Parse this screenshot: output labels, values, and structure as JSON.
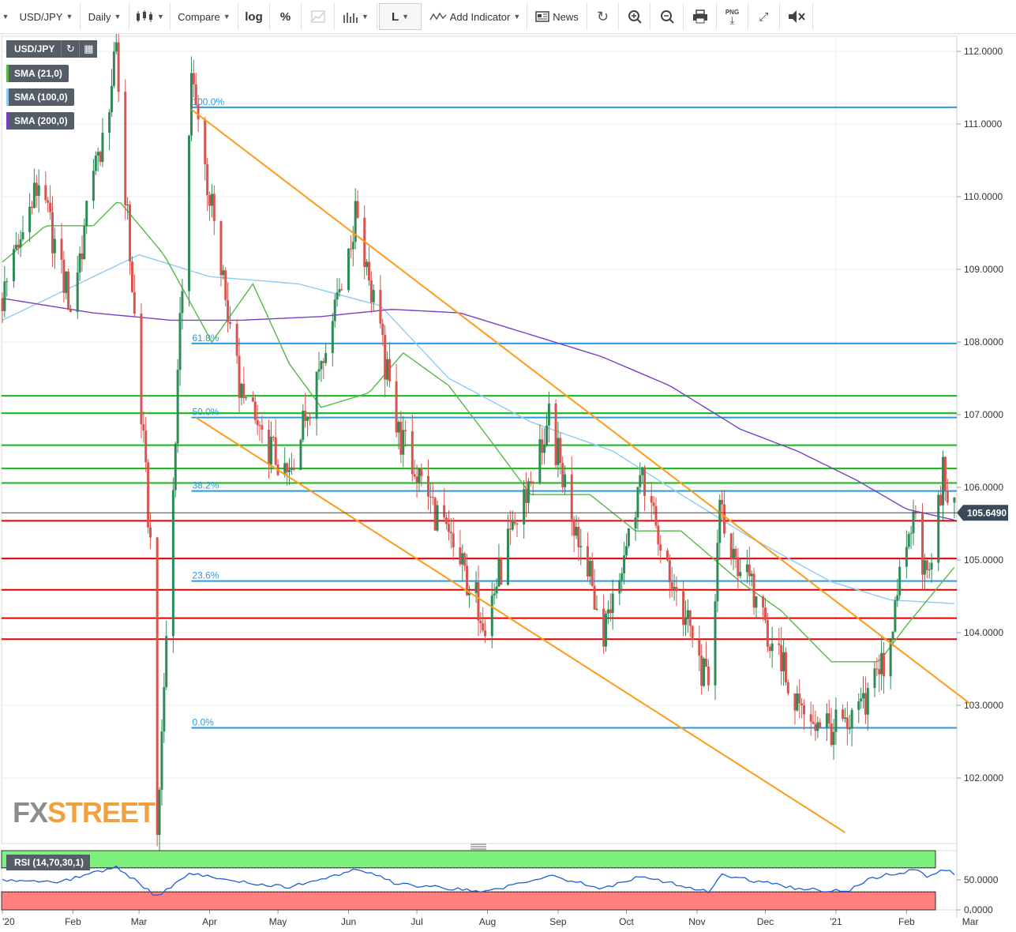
{
  "toolbar": {
    "symbol": "USD/JPY",
    "interval": "Daily",
    "compare": "Compare",
    "log": "log",
    "percent": "%",
    "line_tool": "L",
    "add_indicator": "Add Indicator",
    "news": "News",
    "png": "PNG"
  },
  "legend": {
    "pair": "USD/JPY",
    "sma21": "SMA (21,0)",
    "sma100": "SMA (100,0)",
    "sma200": "SMA (200,0)",
    "rsi": "RSI (14,70,30,1)"
  },
  "watermark": {
    "fx": "FX",
    "street": "STREET"
  },
  "colors": {
    "up": "#2e8b57",
    "down": "#d9534f",
    "sma21": "#55b848",
    "sma100": "#8ecbf2",
    "sma200": "#7a3fc4",
    "fib": "#2a9ae0",
    "support": "#e00000",
    "resistance": "#11bb11",
    "channel": "#ff9a1a",
    "rsi_line": "#1f5fd6",
    "rsi_over": "#7df07d",
    "rsi_under": "#ff7f7f"
  },
  "chart_data": {
    "type": "candlestick",
    "title": "USD/JPY Daily",
    "current_price": 105.649,
    "current_price_label": "105.6490",
    "y_ticks": [
      "112.0000",
      "111.0000",
      "110.0000",
      "109.0000",
      "108.0000",
      "107.0000",
      "106.0000",
      "105.0000",
      "104.0000",
      "103.0000",
      "102.0000"
    ],
    "y_tick_values": [
      112,
      111,
      110,
      109,
      108,
      107,
      106,
      105,
      104,
      103,
      102
    ],
    "x_labels": [
      "'20",
      "Feb",
      "Mar",
      "Apr",
      "May",
      "Jun",
      "Jul",
      "Aug",
      "Sep",
      "Oct",
      "Nov",
      "Dec",
      "'21",
      "Feb",
      "Mar"
    ],
    "ylim": [
      101.15,
      112.2
    ],
    "fibonacci": [
      {
        "label": "100.0%",
        "price": 111.23
      },
      {
        "label": "61.8%",
        "price": 107.98
      },
      {
        "label": "50.0%",
        "price": 106.96
      },
      {
        "label": "38.2%",
        "price": 105.95
      },
      {
        "label": "23.6%",
        "price": 104.71
      },
      {
        "label": "0.0%",
        "price": 102.69
      }
    ],
    "resistance_levels": [
      107.26,
      107.02,
      106.58,
      106.26,
      106.06
    ],
    "support_levels": [
      105.54,
      105.02,
      104.59,
      104.2,
      103.91
    ],
    "trendlines": [
      {
        "from": {
          "date": "2020-03-24",
          "price": 111.2
        },
        "to": {
          "date": "2021-03-01",
          "price": 103.02
        }
      },
      {
        "from": {
          "date": "2020-03-26",
          "price": 106.96
        },
        "to": {
          "date": "2021-01-05",
          "price": 101.25
        }
      }
    ],
    "ohlc_keypoints": [
      {
        "date": "2020-01-01",
        "price": 108.6
      },
      {
        "date": "2020-01-17",
        "price": 110.2
      },
      {
        "date": "2020-01-31",
        "price": 108.5
      },
      {
        "date": "2020-02-20",
        "price": 111.9
      },
      {
        "date": "2020-03-06",
        "price": 105.2
      },
      {
        "date": "2020-03-09",
        "price": 101.2
      },
      {
        "date": "2020-03-24",
        "price": 111.6
      },
      {
        "date": "2020-04-15",
        "price": 107.2
      },
      {
        "date": "2020-05-06",
        "price": 106.1
      },
      {
        "date": "2020-06-05",
        "price": 109.8
      },
      {
        "date": "2020-06-22",
        "price": 106.8
      },
      {
        "date": "2020-07-31",
        "price": 104.2
      },
      {
        "date": "2020-08-28",
        "price": 106.9
      },
      {
        "date": "2020-09-21",
        "price": 104.0
      },
      {
        "date": "2020-10-07",
        "price": 106.1
      },
      {
        "date": "2020-11-06",
        "price": 103.2
      },
      {
        "date": "2020-11-11",
        "price": 105.6
      },
      {
        "date": "2020-12-17",
        "price": 102.9
      },
      {
        "date": "2021-01-06",
        "price": 102.6
      },
      {
        "date": "2021-01-22",
        "price": 103.6
      },
      {
        "date": "2021-02-05",
        "price": 105.7
      },
      {
        "date": "2021-02-10",
        "price": 104.6
      },
      {
        "date": "2021-02-17",
        "price": 106.2
      },
      {
        "date": "2021-02-22",
        "price": 105.65
      }
    ],
    "sma21_keypoints": [
      {
        "date": "2020-01-01",
        "price": 109.1
      },
      {
        "date": "2020-01-20",
        "price": 109.6
      },
      {
        "date": "2020-02-10",
        "price": 109.6
      },
      {
        "date": "2020-02-21",
        "price": 109.95
      },
      {
        "date": "2020-03-12",
        "price": 109.2
      },
      {
        "date": "2020-04-02",
        "price": 108.0
      },
      {
        "date": "2020-04-20",
        "price": 108.8
      },
      {
        "date": "2020-05-06",
        "price": 107.7
      },
      {
        "date": "2020-05-20",
        "price": 107.1
      },
      {
        "date": "2020-06-10",
        "price": 107.3
      },
      {
        "date": "2020-06-25",
        "price": 107.85
      },
      {
        "date": "2020-07-15",
        "price": 107.4
      },
      {
        "date": "2020-08-01",
        "price": 106.7
      },
      {
        "date": "2020-08-20",
        "price": 105.9
      },
      {
        "date": "2020-09-15",
        "price": 105.9
      },
      {
        "date": "2020-10-05",
        "price": 105.4
      },
      {
        "date": "2020-10-25",
        "price": 105.4
      },
      {
        "date": "2020-11-20",
        "price": 104.7
      },
      {
        "date": "2020-12-08",
        "price": 104.3
      },
      {
        "date": "2020-12-30",
        "price": 103.6
      },
      {
        "date": "2021-01-20",
        "price": 103.6
      },
      {
        "date": "2021-02-01",
        "price": 104.1
      },
      {
        "date": "2021-02-22",
        "price": 104.9
      }
    ],
    "sma100_keypoints": [
      {
        "date": "2020-01-01",
        "price": 108.3
      },
      {
        "date": "2020-02-10",
        "price": 108.9
      },
      {
        "date": "2020-03-01",
        "price": 109.2
      },
      {
        "date": "2020-04-01",
        "price": 108.9
      },
      {
        "date": "2020-05-10",
        "price": 108.8
      },
      {
        "date": "2020-06-15",
        "price": 108.5
      },
      {
        "date": "2020-07-15",
        "price": 107.5
      },
      {
        "date": "2020-08-20",
        "price": 106.9
      },
      {
        "date": "2020-09-25",
        "price": 106.5
      },
      {
        "date": "2020-10-25",
        "price": 105.9
      },
      {
        "date": "2020-11-25",
        "price": 105.3
      },
      {
        "date": "2020-12-30",
        "price": 104.7
      },
      {
        "date": "2021-01-25",
        "price": 104.45
      },
      {
        "date": "2021-02-22",
        "price": 104.4
      }
    ],
    "sma200_keypoints": [
      {
        "date": "2020-01-01",
        "price": 108.6
      },
      {
        "date": "2020-02-10",
        "price": 108.4
      },
      {
        "date": "2020-03-15",
        "price": 108.3
      },
      {
        "date": "2020-04-15",
        "price": 108.3
      },
      {
        "date": "2020-05-20",
        "price": 108.35
      },
      {
        "date": "2020-06-20",
        "price": 108.45
      },
      {
        "date": "2020-07-20",
        "price": 108.4
      },
      {
        "date": "2020-08-20",
        "price": 108.1
      },
      {
        "date": "2020-09-20",
        "price": 107.8
      },
      {
        "date": "2020-10-20",
        "price": 107.4
      },
      {
        "date": "2020-11-20",
        "price": 106.8
      },
      {
        "date": "2020-12-15",
        "price": 106.5
      },
      {
        "date": "2021-01-10",
        "price": 106.1
      },
      {
        "date": "2021-02-01",
        "price": 105.7
      },
      {
        "date": "2021-02-22",
        "price": 105.55
      }
    ],
    "rsi": {
      "levels": [
        70,
        30
      ],
      "y_ticks": [
        "50.0000",
        "0.0000"
      ],
      "keypoints": [
        {
          "date": "2020-01-01",
          "value": 50
        },
        {
          "date": "2020-01-25",
          "value": 45
        },
        {
          "date": "2020-02-20",
          "value": 72
        },
        {
          "date": "2020-03-09",
          "value": 22
        },
        {
          "date": "2020-03-24",
          "value": 62
        },
        {
          "date": "2020-04-15",
          "value": 46
        },
        {
          "date": "2020-05-06",
          "value": 38
        },
        {
          "date": "2020-06-05",
          "value": 68
        },
        {
          "date": "2020-06-22",
          "value": 44
        },
        {
          "date": "2020-07-31",
          "value": 30
        },
        {
          "date": "2020-08-28",
          "value": 57
        },
        {
          "date": "2020-09-21",
          "value": 35
        },
        {
          "date": "2020-10-07",
          "value": 57
        },
        {
          "date": "2020-11-06",
          "value": 30
        },
        {
          "date": "2020-11-11",
          "value": 58
        },
        {
          "date": "2020-12-17",
          "value": 35
        },
        {
          "date": "2021-01-06",
          "value": 30
        },
        {
          "date": "2021-01-15",
          "value": 52
        },
        {
          "date": "2021-02-05",
          "value": 67
        },
        {
          "date": "2021-02-10",
          "value": 54
        },
        {
          "date": "2021-02-17",
          "value": 68
        },
        {
          "date": "2021-02-22",
          "value": 60
        }
      ]
    }
  }
}
